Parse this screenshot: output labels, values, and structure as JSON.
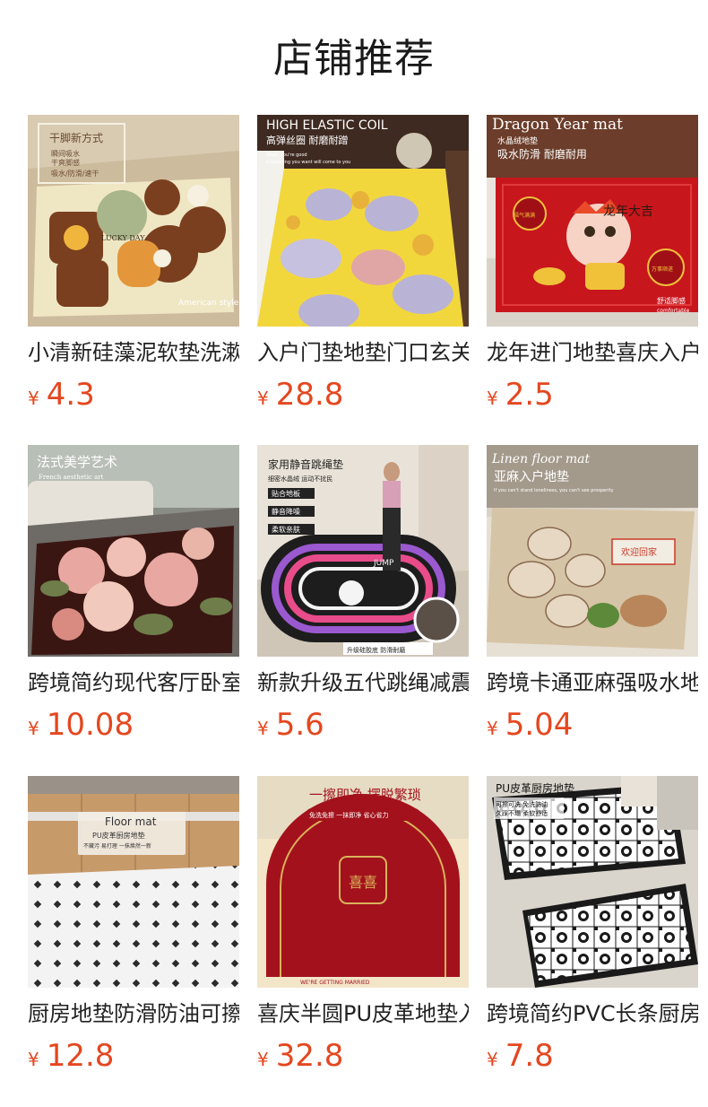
{
  "section_title": "店铺推荐",
  "currency": "¥",
  "products": [
    {
      "name": "小清新硅藻泥软垫洗漱台防水垫",
      "price": "4.3",
      "image_text": [
        "干脚新方式",
        "瞬间吸水",
        "干爽脚感",
        "吸水/防滑/速干",
        "LUCKY DAY",
        "American style"
      ],
      "image_colors": [
        "#efe6c4",
        "#7a3f1e",
        "#d8c9b0"
      ]
    },
    {
      "name": "入户门垫地垫门口玄关地毯",
      "price": "28.8",
      "image_text": [
        "HIGH ELASTIC COIL",
        "高弹丝圈 耐磨耐蹭",
        "When you're good",
        "everything you want will come to you"
      ],
      "image_colors": [
        "#f2d73c",
        "#b9b3d6",
        "#8a5a3c"
      ]
    },
    {
      "name": "龙年进门地垫喜庆入户门垫",
      "price": "2.5",
      "image_text": [
        "Dragon Year mat",
        "水晶绒地垫",
        "吸水防滑 耐磨耐用",
        "龙年大吉",
        "福气满满",
        "万事顺遂",
        "舒适脚感",
        "comfortable"
      ],
      "image_colors": [
        "#c8161d",
        "#f0c23a",
        "#6b3d2a"
      ]
    },
    {
      "name": "跨境简约现代客厅卧室地毯",
      "price": "10.08",
      "image_text": [
        "法式美学艺术",
        "French aesthetic art"
      ],
      "image_colors": [
        "#3a1612",
        "#e8a7a0",
        "#6e7d4a"
      ]
    },
    {
      "name": "新款升级五代跳绳减震垫",
      "price": "5.6",
      "image_text": [
        "家用静音跳绳垫",
        "细密水晶绒 运动不扰民",
        "贴合地板",
        "静音降噪",
        "柔软亲肤",
        "JUMP",
        "升级硅胶底 防滑耐磨"
      ],
      "image_colors": [
        "#1d1d1d",
        "#9b59d0",
        "#e84c8a"
      ]
    },
    {
      "name": "跨境卡通亚麻强吸水地垫",
      "price": "5.04",
      "image_text": [
        "Linen floor mat",
        "亚麻入户地垫",
        "If you can't stand loneliness, you can't see prosperity",
        "欢迎回家"
      ],
      "image_colors": [
        "#d6c4a6",
        "#c83a2a",
        "#5c8a3a"
      ]
    },
    {
      "name": "厨房地垫防滑防油可擦免洗",
      "price": "12.8",
      "image_text": [
        "Floor mat",
        "PU皮革厨房地垫",
        "不藏污 易打理 一抹焕然一新"
      ],
      "image_colors": [
        "#f3f3f3",
        "#c79a6a",
        "#333333"
      ]
    },
    {
      "name": "喜庆半圆PU皮革地垫入户",
      "price": "32.8",
      "image_text": [
        "一擦即净 摆脱繁琐",
        "免洗免擦 一抹即净 省心省力",
        "喜喜",
        "WE'RE GETTING MARRIED"
      ],
      "image_colors": [
        "#a3121c",
        "#f3e6c8",
        "#d9b25a"
      ]
    },
    {
      "name": "跨境简约PVC长条厨房地垫",
      "price": "7.8",
      "image_text": [
        "PU皮革厨房地垫",
        "可擦可洗 免洗防油",
        "久踩不塌 柔软舒适"
      ],
      "image_colors": [
        "#ffffff",
        "#1a1a1a",
        "#d9d5cc"
      ]
    }
  ]
}
